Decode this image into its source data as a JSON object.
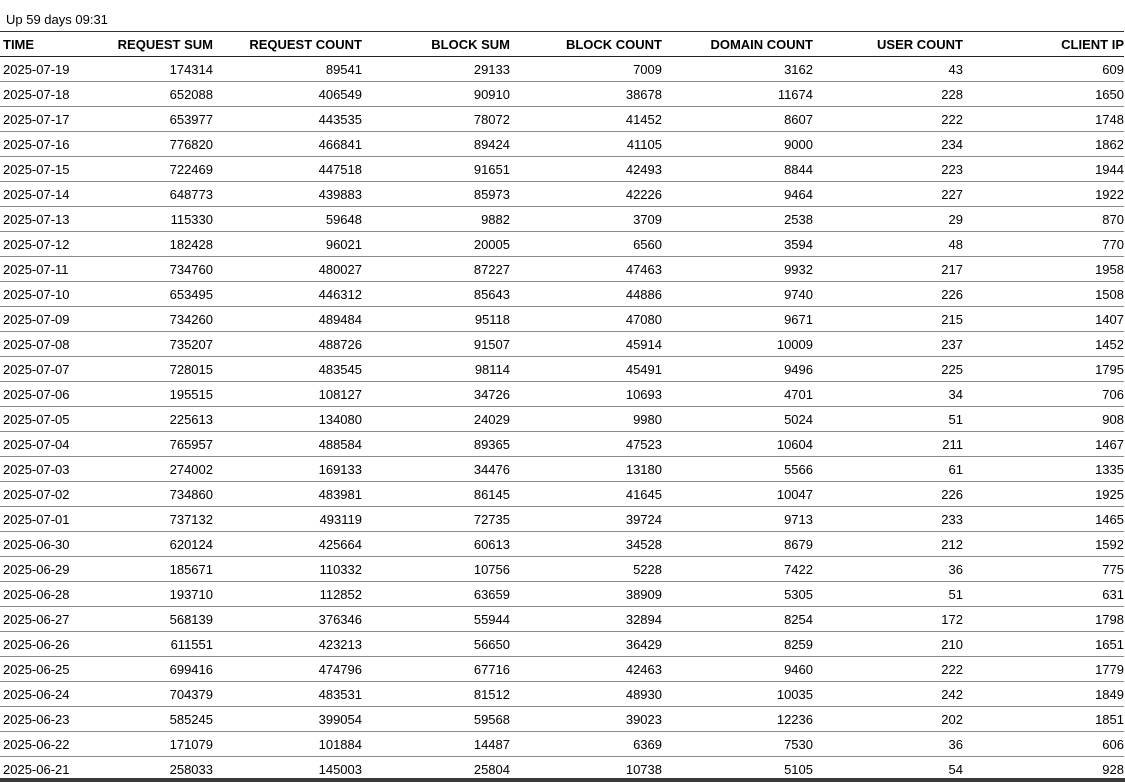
{
  "status": {
    "uptime": "Up 59 days 09:31"
  },
  "table": {
    "columns": [
      "TIME",
      "REQUEST SUM",
      "REQUEST COUNT",
      "BLOCK SUM",
      "BLOCK COUNT",
      "DOMAIN COUNT",
      "USER COUNT",
      "CLIENT IP"
    ],
    "rows": [
      [
        "2025-07-19",
        "174314",
        "89541",
        "29133",
        "7009",
        "3162",
        "43",
        "609"
      ],
      [
        "2025-07-18",
        "652088",
        "406549",
        "90910",
        "38678",
        "11674",
        "228",
        "1650"
      ],
      [
        "2025-07-17",
        "653977",
        "443535",
        "78072",
        "41452",
        "8607",
        "222",
        "1748"
      ],
      [
        "2025-07-16",
        "776820",
        "466841",
        "89424",
        "41105",
        "9000",
        "234",
        "1862"
      ],
      [
        "2025-07-15",
        "722469",
        "447518",
        "91651",
        "42493",
        "8844",
        "223",
        "1944"
      ],
      [
        "2025-07-14",
        "648773",
        "439883",
        "85973",
        "42226",
        "9464",
        "227",
        "1922"
      ],
      [
        "2025-07-13",
        "115330",
        "59648",
        "9882",
        "3709",
        "2538",
        "29",
        "870"
      ],
      [
        "2025-07-12",
        "182428",
        "96021",
        "20005",
        "6560",
        "3594",
        "48",
        "770"
      ],
      [
        "2025-07-11",
        "734760",
        "480027",
        "87227",
        "47463",
        "9932",
        "217",
        "1958"
      ],
      [
        "2025-07-10",
        "653495",
        "446312",
        "85643",
        "44886",
        "9740",
        "226",
        "1508"
      ],
      [
        "2025-07-09",
        "734260",
        "489484",
        "95118",
        "47080",
        "9671",
        "215",
        "1407"
      ],
      [
        "2025-07-08",
        "735207",
        "488726",
        "91507",
        "45914",
        "10009",
        "237",
        "1452"
      ],
      [
        "2025-07-07",
        "728015",
        "483545",
        "98114",
        "45491",
        "9496",
        "225",
        "1795"
      ],
      [
        "2025-07-06",
        "195515",
        "108127",
        "34726",
        "10693",
        "4701",
        "34",
        "706"
      ],
      [
        "2025-07-05",
        "225613",
        "134080",
        "24029",
        "9980",
        "5024",
        "51",
        "908"
      ],
      [
        "2025-07-04",
        "765957",
        "488584",
        "89365",
        "47523",
        "10604",
        "211",
        "1467"
      ],
      [
        "2025-07-03",
        "274002",
        "169133",
        "34476",
        "13180",
        "5566",
        "61",
        "1335"
      ],
      [
        "2025-07-02",
        "734860",
        "483981",
        "86145",
        "41645",
        "10047",
        "226",
        "1925"
      ],
      [
        "2025-07-01",
        "737132",
        "493119",
        "72735",
        "39724",
        "9713",
        "233",
        "1465"
      ],
      [
        "2025-06-30",
        "620124",
        "425664",
        "60613",
        "34528",
        "8679",
        "212",
        "1592"
      ],
      [
        "2025-06-29",
        "185671",
        "110332",
        "10756",
        "5228",
        "7422",
        "36",
        "775"
      ],
      [
        "2025-06-28",
        "193710",
        "112852",
        "63659",
        "38909",
        "5305",
        "51",
        "631"
      ],
      [
        "2025-06-27",
        "568139",
        "376346",
        "55944",
        "32894",
        "8254",
        "172",
        "1798"
      ],
      [
        "2025-06-26",
        "611551",
        "423213",
        "56650",
        "36429",
        "8259",
        "210",
        "1651"
      ],
      [
        "2025-06-25",
        "699416",
        "474796",
        "67716",
        "42463",
        "9460",
        "222",
        "1779"
      ],
      [
        "2025-06-24",
        "704379",
        "483531",
        "81512",
        "48930",
        "10035",
        "242",
        "1849"
      ],
      [
        "2025-06-23",
        "585245",
        "399054",
        "59568",
        "39023",
        "12236",
        "202",
        "1851"
      ],
      [
        "2025-06-22",
        "171079",
        "101884",
        "14487",
        "6369",
        "7530",
        "36",
        "606"
      ],
      [
        "2025-06-21",
        "258033",
        "145003",
        "25804",
        "10738",
        "5105",
        "54",
        "928"
      ]
    ]
  }
}
